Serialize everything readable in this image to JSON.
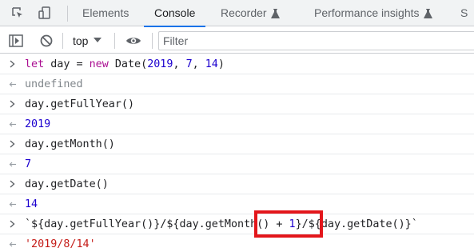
{
  "tabbar": {
    "icons": [
      "inspect-element-icon",
      "device-toolbar-icon"
    ],
    "tabs": [
      {
        "label": "Elements",
        "active": false,
        "experimental": false
      },
      {
        "label": "Console",
        "active": true,
        "experimental": false
      },
      {
        "label": "Recorder",
        "active": false,
        "experimental": true
      },
      {
        "label": "Performance insights",
        "active": false,
        "experimental": true
      }
    ],
    "overflow_label": "S"
  },
  "toolbar": {
    "icons": [
      "show-sidebar-icon",
      "clear-console-icon",
      "live-expression-eye-icon"
    ],
    "context_label": "top",
    "filter_placeholder": "Filter"
  },
  "console": {
    "entries": [
      {
        "type": "input",
        "tokens": [
          {
            "text": "let",
            "class": "kw"
          },
          {
            "text": " day = ",
            "class": "plain"
          },
          {
            "text": "new",
            "class": "kw"
          },
          {
            "text": " Date(",
            "class": "plain"
          },
          {
            "text": "2019",
            "class": "num"
          },
          {
            "text": ", ",
            "class": "plain"
          },
          {
            "text": "7",
            "class": "num"
          },
          {
            "text": ", ",
            "class": "plain"
          },
          {
            "text": "14",
            "class": "num"
          },
          {
            "text": ")",
            "class": "plain"
          }
        ]
      },
      {
        "type": "output",
        "tokens": [
          {
            "text": "undefined",
            "class": "undef"
          }
        ]
      },
      {
        "type": "input",
        "tokens": [
          {
            "text": "day.getFullYear()",
            "class": "plain"
          }
        ]
      },
      {
        "type": "output",
        "tokens": [
          {
            "text": "2019",
            "class": "num"
          }
        ]
      },
      {
        "type": "input",
        "tokens": [
          {
            "text": "day.getMonth()",
            "class": "plain"
          }
        ]
      },
      {
        "type": "output",
        "tokens": [
          {
            "text": "7",
            "class": "num"
          }
        ]
      },
      {
        "type": "input",
        "tokens": [
          {
            "text": "day.getDate()",
            "class": "plain"
          }
        ]
      },
      {
        "type": "output",
        "tokens": [
          {
            "text": "14",
            "class": "num"
          }
        ]
      },
      {
        "type": "input",
        "tokens": [
          {
            "text": "`${day.getFullYear()}/${day.getMonth() + ",
            "class": "plain"
          },
          {
            "text": "1",
            "class": "num"
          },
          {
            "text": "}/${day.getDate()}`",
            "class": "plain"
          }
        ]
      },
      {
        "type": "output",
        "tokens": [
          {
            "text": "'2019/8/14'",
            "class": "str"
          }
        ]
      }
    ]
  },
  "colors": {
    "keyword": "#aa0d91",
    "number": "#1c00cf",
    "string": "#c41a16",
    "undefined": "#80868b",
    "active_tab_underline": "#1a73e8",
    "highlight_box": "#e3161b"
  }
}
